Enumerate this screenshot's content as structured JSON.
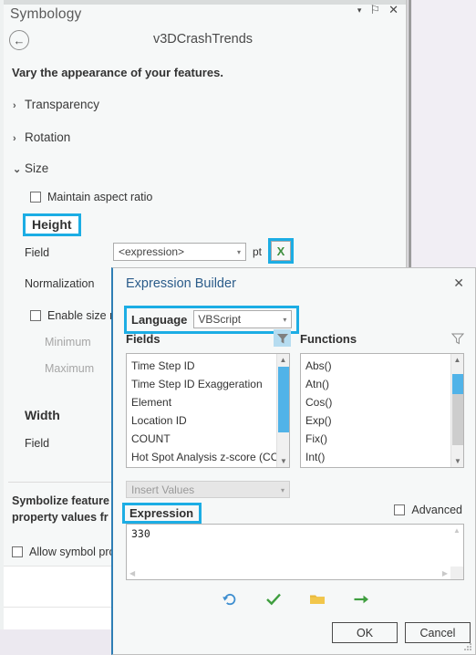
{
  "pane": {
    "title": "Symbology",
    "controls": {
      "menu": "▾",
      "pin": "⚐",
      "close": "✕"
    },
    "back_icon": "←",
    "layer_name": "v3DCrashTrends",
    "intro": "Vary the appearance of your features.",
    "sections": [
      {
        "label": "Transparency",
        "chevron": "›",
        "expanded": false
      },
      {
        "label": "Rotation",
        "chevron": "›",
        "expanded": false
      },
      {
        "label": "Size",
        "chevron": "⌄",
        "expanded": true
      }
    ],
    "maintain_aspect_ratio": "Maintain aspect ratio",
    "height_label": "Height",
    "field_label": "Field",
    "field_value": "<expression>",
    "unit": "pt",
    "expression_button_glyph": "X",
    "normalization_label": "Normalization",
    "enable_size_range": "Enable size ran",
    "minimum_label": "Minimum",
    "maximum_label": "Maximum",
    "width_label": "Width",
    "field2_label": "Field",
    "symbolize_line1": "Symbolize feature",
    "symbolize_line2": "property values fr",
    "allow_symbol": "Allow symbol pro",
    "caret": "▾"
  },
  "dialog": {
    "title": "Expression Builder",
    "close": "✕",
    "language_label": "Language",
    "language_value": "VBScript",
    "fields_header": "Fields",
    "functions_header": "Functions",
    "filter_icon": "ᐳ",
    "fields": [
      "Time Step ID",
      "Time Step ID Exaggeration",
      "Element",
      "Location ID",
      "COUNT",
      "Hot Spot Analysis z-score (COU"
    ],
    "functions": [
      "Abs()",
      "Atn()",
      "Cos()",
      "Exp()",
      "Fix()",
      "Int()"
    ],
    "insert_values_placeholder": "Insert Values",
    "expression_label": "Expression",
    "advanced_label": "Advanced",
    "expression_value": "330",
    "toolbar": [
      {
        "name": "undo-icon",
        "glyph": "↺",
        "color": "#3f8fd0"
      },
      {
        "name": "verify-icon",
        "glyph": "✔",
        "color": "#3f9e3f"
      },
      {
        "name": "open-icon",
        "glyph": "▰",
        "color": "#e8b93c"
      },
      {
        "name": "export-icon",
        "glyph": "→",
        "color": "#3f9e3f"
      }
    ],
    "ok_label": "OK",
    "cancel_label": "Cancel"
  },
  "colors": {
    "highlight": "#1cade4",
    "dialog_accent": "#2e7eb5",
    "scroll_thumb": "#51b3e8"
  }
}
